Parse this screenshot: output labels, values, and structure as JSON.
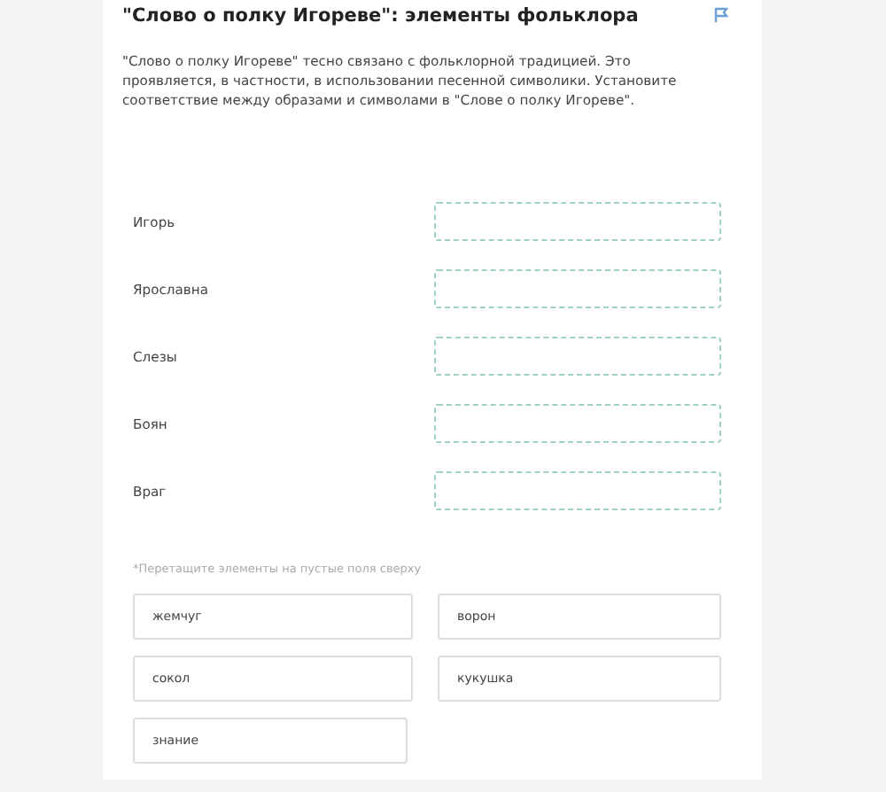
{
  "title": "\"Слово о полку Игореве\": элементы фольклора",
  "description": "\"Слово о полку Игореве\" тесно связано с фольклорной традицией. Это проявляется, в частности, в использовании песенной символики. Установите соответствие между образами и символами в \"Слове о полку Игореве\".",
  "pairs": [
    {
      "label": "Игорь"
    },
    {
      "label": "Ярославна"
    },
    {
      "label": "Слезы"
    },
    {
      "label": "Боян"
    },
    {
      "label": "Враг"
    }
  ],
  "hint": "*Перетащите элементы на пустые поля сверху",
  "options": [
    "жемчуг",
    "ворон",
    "сокол",
    "кукушка",
    "знание"
  ]
}
